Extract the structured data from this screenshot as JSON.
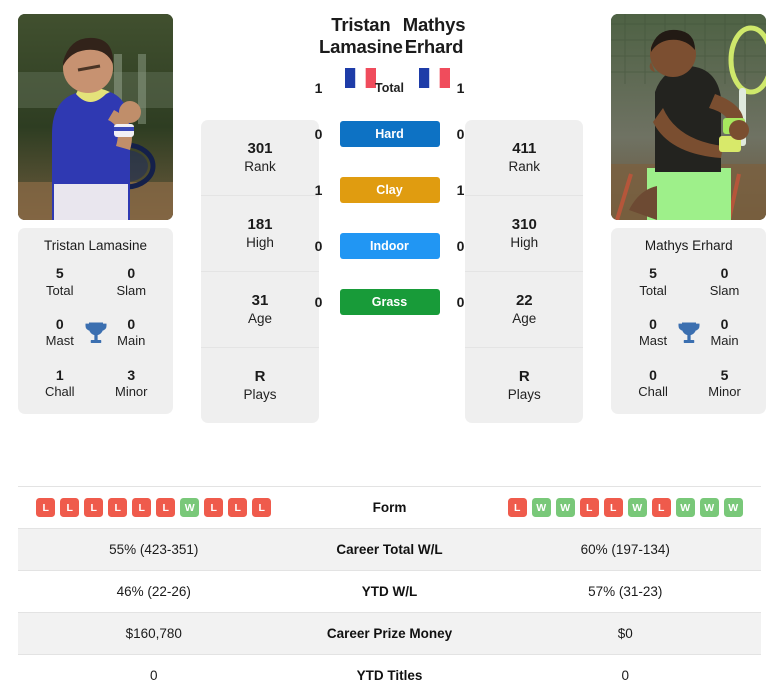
{
  "players": {
    "left": {
      "first_name": "Tristan",
      "last_name": "Lamasine",
      "full_name": "Tristan Lamasine",
      "country": "France",
      "rank": "301",
      "rank_label": "Rank",
      "high": "181",
      "high_label": "High",
      "age": "31",
      "age_label": "Age",
      "plays": "R",
      "plays_label": "Plays",
      "titles": {
        "total": "5",
        "total_label": "Total",
        "slam": "0",
        "slam_label": "Slam",
        "mast": "0",
        "mast_label": "Mast",
        "main": "0",
        "main_label": "Main",
        "chall": "1",
        "chall_label": "Chall",
        "minor": "3",
        "minor_label": "Minor"
      },
      "form": [
        "L",
        "L",
        "L",
        "L",
        "L",
        "L",
        "W",
        "L",
        "L",
        "L"
      ],
      "career_wl": "55% (423-351)",
      "ytd_wl": "46% (22-26)",
      "career_prize": "$160,780",
      "ytd_titles": "0"
    },
    "right": {
      "first_name": "Mathys",
      "last_name": "Erhard",
      "full_name": "Mathys Erhard",
      "country": "France",
      "rank": "411",
      "rank_label": "Rank",
      "high": "310",
      "high_label": "High",
      "age": "22",
      "age_label": "Age",
      "plays": "R",
      "plays_label": "Plays",
      "titles": {
        "total": "5",
        "total_label": "Total",
        "slam": "0",
        "slam_label": "Slam",
        "mast": "0",
        "mast_label": "Mast",
        "main": "0",
        "main_label": "Main",
        "chall": "0",
        "chall_label": "Chall",
        "minor": "5",
        "minor_label": "Minor"
      },
      "form": [
        "L",
        "W",
        "W",
        "L",
        "L",
        "W",
        "L",
        "W",
        "W",
        "W"
      ],
      "career_wl": "60% (197-134)",
      "ytd_wl": "57% (31-23)",
      "career_prize": "$0",
      "ytd_titles": "0"
    }
  },
  "head_to_head": {
    "total": {
      "label": "Total",
      "left": "1",
      "right": "1"
    },
    "surfaces": [
      {
        "label": "Hard",
        "left": "0",
        "right": "0",
        "color": "#0d72c4"
      },
      {
        "label": "Clay",
        "left": "1",
        "right": "1",
        "color": "#e09c10"
      },
      {
        "label": "Indoor",
        "left": "0",
        "right": "0",
        "color": "#2196f3"
      },
      {
        "label": "Grass",
        "left": "0",
        "right": "0",
        "color": "#189b39"
      }
    ]
  },
  "table": {
    "rows": [
      {
        "label": "Form"
      },
      {
        "label": "Career Total W/L"
      },
      {
        "label": "YTD W/L"
      },
      {
        "label": "Career Prize Money"
      },
      {
        "label": "YTD Titles"
      }
    ]
  }
}
